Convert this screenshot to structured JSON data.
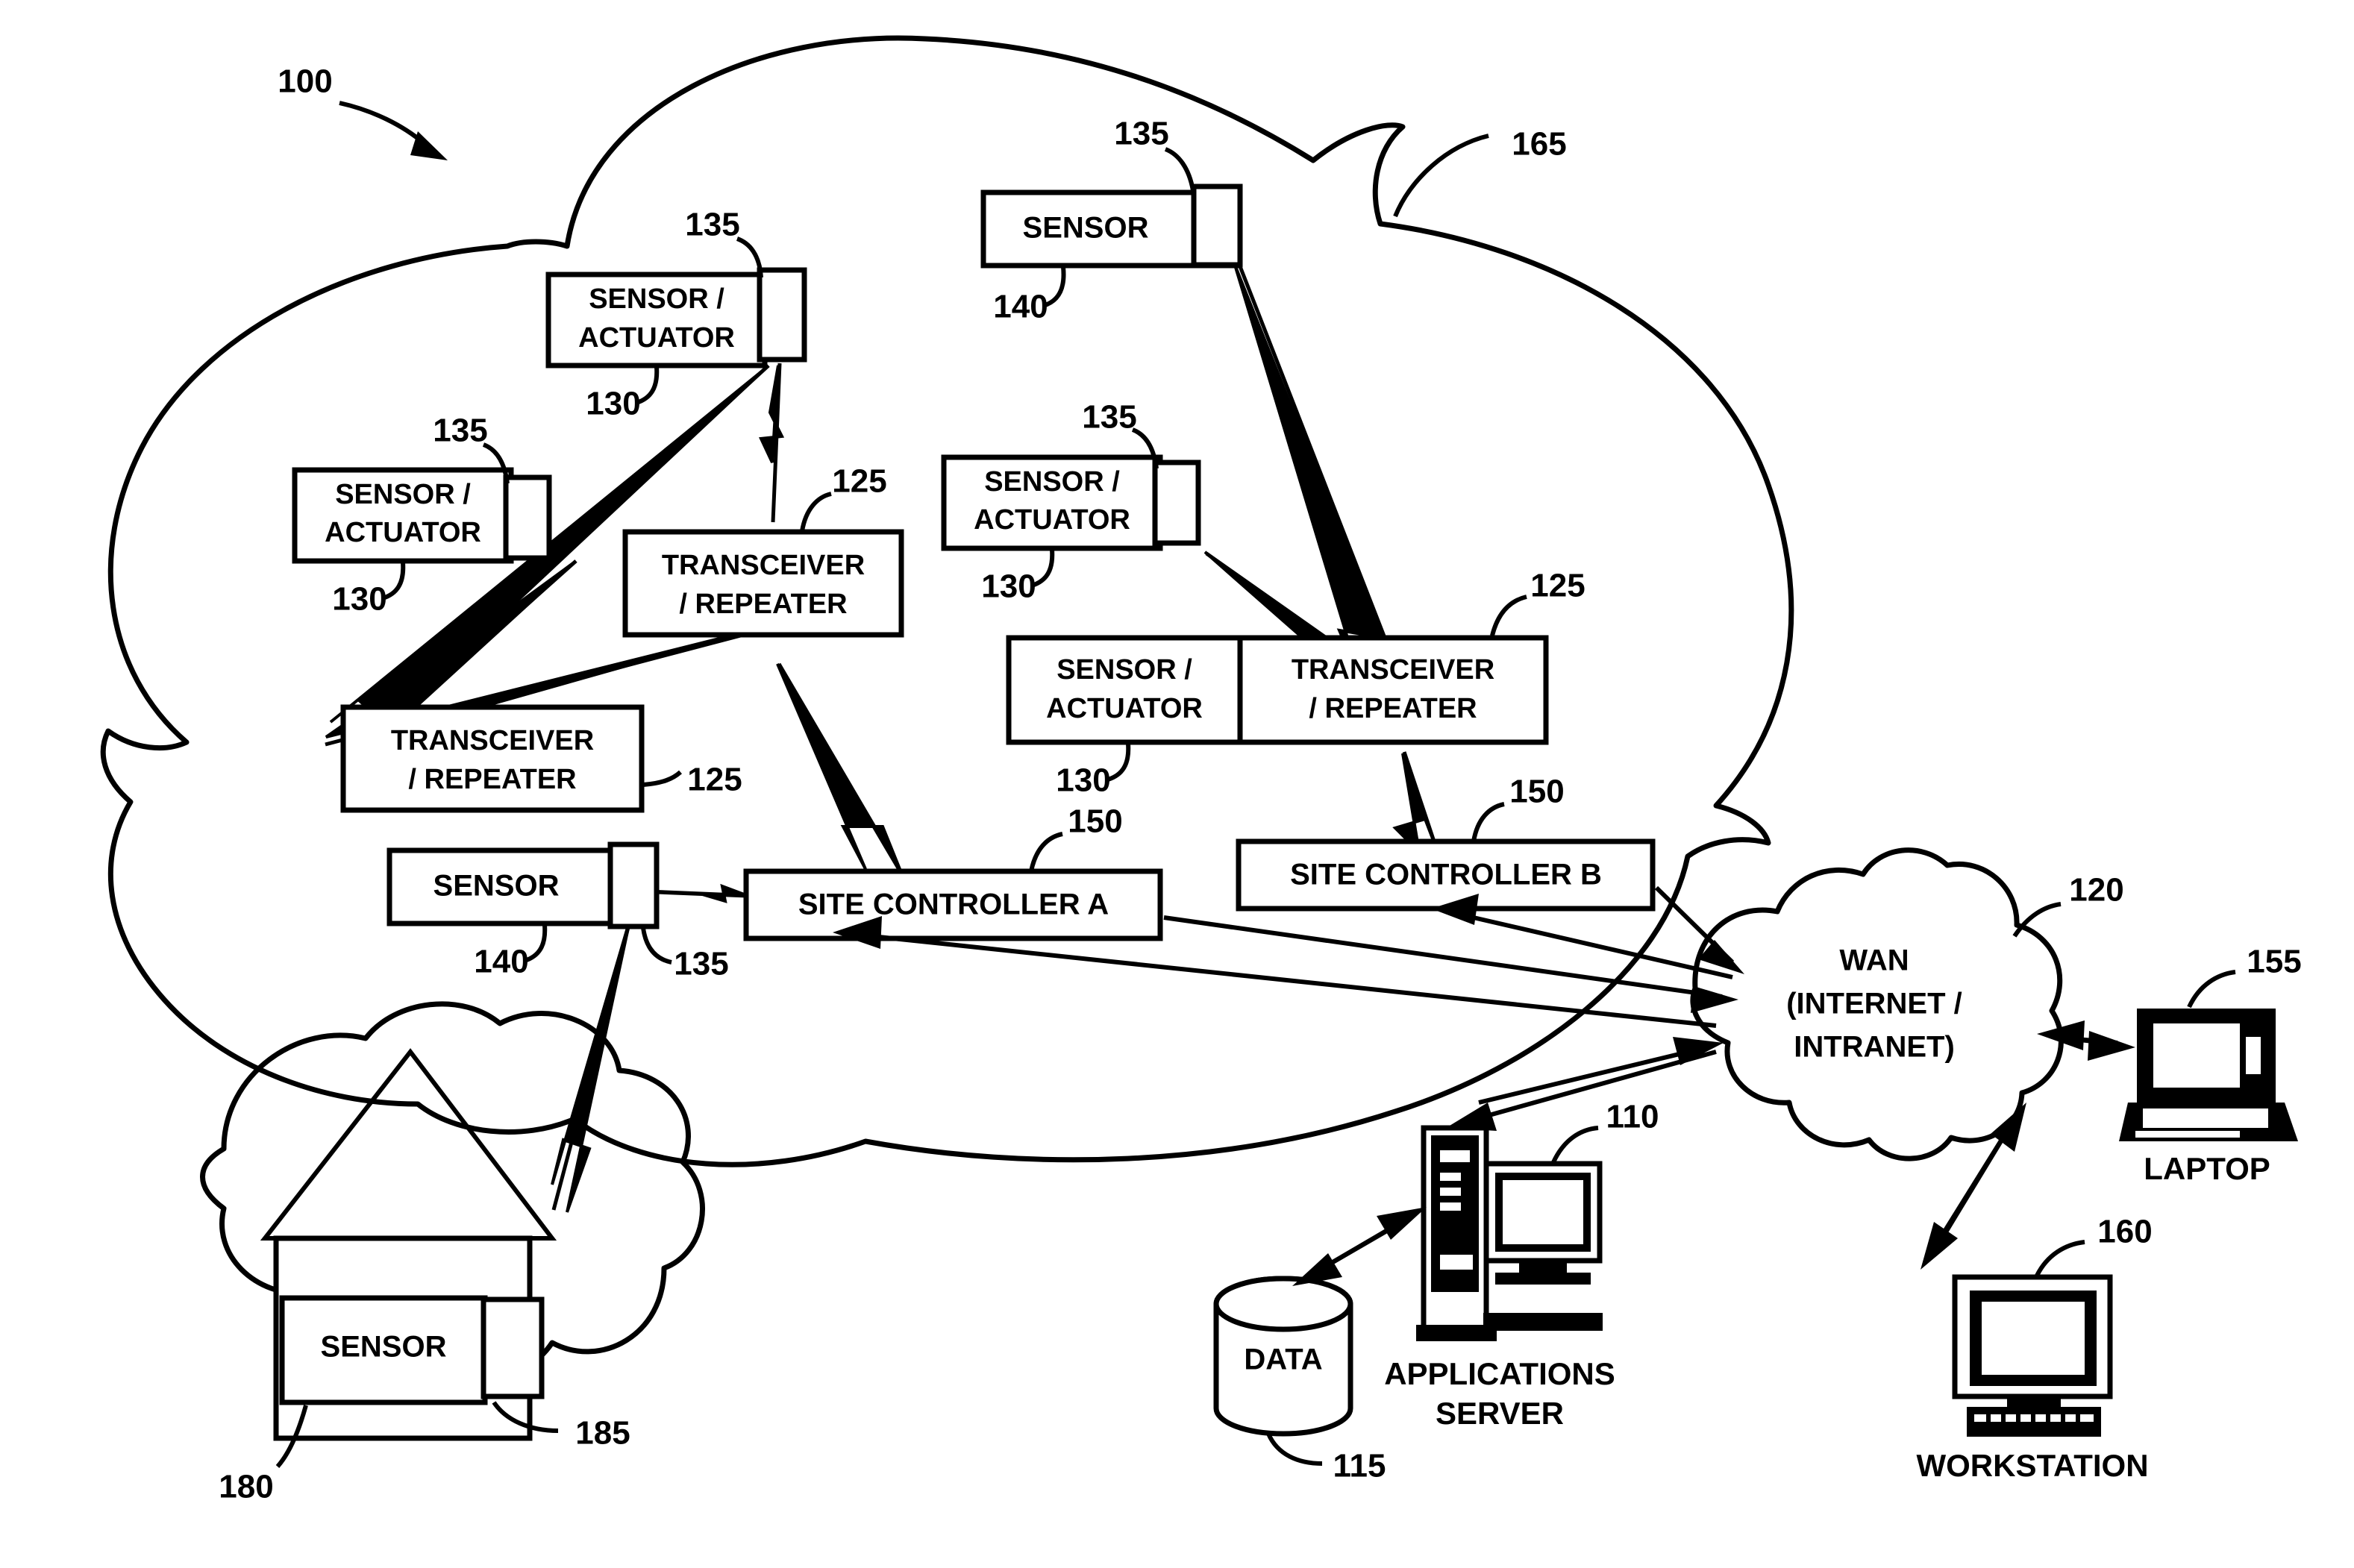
{
  "figure": {
    "title_ref": "100",
    "network_cloud_ref": "165",
    "wan_cloud_ref": "120",
    "home_cloud_ref": "180"
  },
  "nodes": {
    "sensor_actuator_top": {
      "line1": "SENSOR /",
      "line2": "ACTUATOR",
      "ref": "130",
      "antenna_ref": "135"
    },
    "sensor_actuator_left": {
      "line1": "SENSOR /",
      "line2": "ACTUATOR",
      "ref": "130",
      "antenna_ref": "135"
    },
    "sensor_actuator_mid": {
      "line1": "SENSOR /",
      "line2": "ACTUATOR",
      "ref": "130",
      "antenna_ref": "135"
    },
    "sensor_actuator_right": {
      "line1": "SENSOR /",
      "line2": "ACTUATOR",
      "ref": "130"
    },
    "sensor_top": {
      "label": "SENSOR",
      "ref": "140",
      "antenna_ref": "135"
    },
    "sensor_lower": {
      "label": "SENSOR",
      "ref": "140",
      "antenna_ref": "135"
    },
    "sensor_home": {
      "label": "SENSOR",
      "ref": "185"
    },
    "transceiver_center": {
      "line1": "TRANSCEIVER",
      "line2": "/ REPEATER",
      "ref": "125"
    },
    "transceiver_left": {
      "line1": "TRANSCEIVER",
      "line2": "/ REPEATER",
      "ref": "125"
    },
    "transceiver_right": {
      "line1": "TRANSCEIVER",
      "line2": "/ REPEATER",
      "ref": "125"
    },
    "site_controller_a": {
      "label": "SITE CONTROLLER A",
      "ref": "150"
    },
    "site_controller_b": {
      "label": "SITE CONTROLLER B",
      "ref": "150"
    },
    "wan": {
      "line1": "WAN",
      "line2": "(INTERNET /",
      "line3": "INTRANET)",
      "ref": "120"
    },
    "applications_server": {
      "line1": "APPLICATIONS",
      "line2": "SERVER",
      "ref": "110"
    },
    "data_store": {
      "label": "DATA",
      "ref": "115"
    },
    "laptop": {
      "label": "LAPTOP",
      "ref": "155"
    },
    "workstation": {
      "label": "WORKSTATION",
      "ref": "160"
    }
  },
  "colors": {
    "ink": "#000000",
    "paper": "#ffffff"
  }
}
